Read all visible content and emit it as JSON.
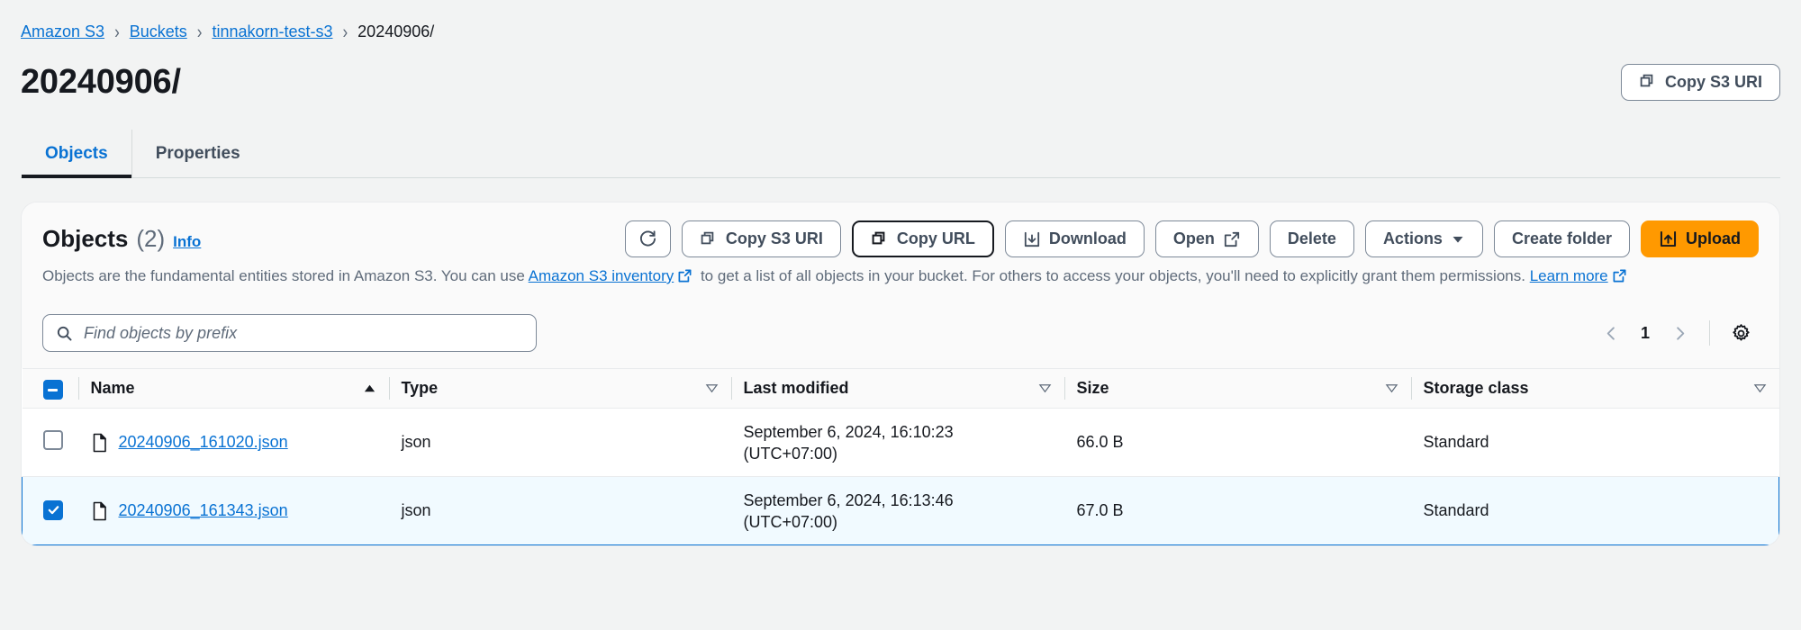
{
  "breadcrumb": {
    "items": [
      {
        "label": "Amazon S3",
        "link": true
      },
      {
        "label": "Buckets",
        "link": true
      },
      {
        "label": "tinnakorn-test-s3",
        "link": true
      },
      {
        "label": "20240906/",
        "link": false
      }
    ],
    "separator": "›"
  },
  "header": {
    "title": "20240906/",
    "copy_uri_button": "Copy S3 URI"
  },
  "tabs": [
    {
      "label": "Objects",
      "active": true
    },
    {
      "label": "Properties",
      "active": false
    }
  ],
  "objects_panel": {
    "title": "Objects",
    "count": "(2)",
    "info_link": "Info",
    "description_part1": "Objects are the fundamental entities stored in Amazon S3. You can use ",
    "description_link1": "Amazon S3 inventory",
    "description_part2": " to get a list of all objects in your bucket. For others to access your objects, you'll need to explicitly grant them permissions. ",
    "description_link2": "Learn more",
    "actions": [
      {
        "name": "refresh",
        "label": "",
        "icon": "refresh-icon",
        "variant": "icon"
      },
      {
        "name": "copy-s3-uri",
        "label": "Copy S3 URI",
        "icon": "copy-icon",
        "variant": "normal"
      },
      {
        "name": "copy-url",
        "label": "Copy URL",
        "icon": "copy-icon",
        "variant": "focused"
      },
      {
        "name": "download",
        "label": "Download",
        "icon": "download-icon",
        "variant": "normal"
      },
      {
        "name": "open",
        "label": "Open",
        "icon": "external-link-icon",
        "variant": "normal",
        "icon_after": true
      },
      {
        "name": "delete",
        "label": "Delete",
        "icon": "",
        "variant": "normal"
      },
      {
        "name": "actions",
        "label": "Actions",
        "icon": "chevron-down-icon",
        "variant": "normal",
        "icon_after": true
      },
      {
        "name": "create-folder",
        "label": "Create folder",
        "icon": "",
        "variant": "normal"
      },
      {
        "name": "upload",
        "label": "Upload",
        "icon": "upload-icon",
        "variant": "primary"
      }
    ],
    "search_placeholder": "Find objects by prefix",
    "search_value": "",
    "pagination": {
      "page": "1",
      "prev": "‹",
      "next": "›"
    },
    "columns": [
      {
        "label": "Name",
        "sort": "asc"
      },
      {
        "label": "Type",
        "sort": "none"
      },
      {
        "label": "Last modified",
        "sort": "none"
      },
      {
        "label": "Size",
        "sort": "none"
      },
      {
        "label": "Storage class",
        "sort": "none"
      }
    ],
    "select_all_state": "indeterminate",
    "rows": [
      {
        "selected": false,
        "name": "20240906_161020.json",
        "type": "json",
        "last_modified_line1": "September 6, 2024, 16:10:23",
        "last_modified_line2": "(UTC+07:00)",
        "size": "66.0 B",
        "storage_class": "Standard"
      },
      {
        "selected": true,
        "name": "20240906_161343.json",
        "type": "json",
        "last_modified_line1": "September 6, 2024, 16:13:46",
        "last_modified_line2": "(UTC+07:00)",
        "size": "67.0 B",
        "storage_class": "Standard"
      }
    ]
  },
  "colors": {
    "link": "#0972d3",
    "accent_orange": "#ff9900",
    "page_bg": "#f2f3f3",
    "selected_row": "#f1faff",
    "text": "#16191f",
    "muted": "#5f6b7a"
  }
}
